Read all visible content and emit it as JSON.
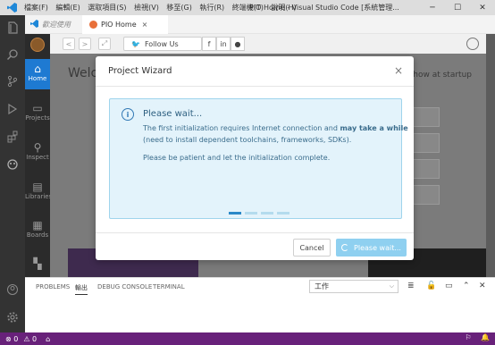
{
  "titlebar": {
    "menu": [
      "檔案(F)",
      "編輯(E)",
      "選取項目(S)",
      "檢視(V)",
      "移至(G)",
      "執行(R)",
      "終端機(T)",
      "說明(H)"
    ],
    "title": "PIO Home - Visual Studio Code [系統管理...",
    "minimize": "─",
    "maximize": "☐",
    "close": "✕"
  },
  "tabs": [
    {
      "label": "歡迎使用"
    },
    {
      "label": "PIO Home",
      "close": "×"
    }
  ],
  "pio_sidebar": {
    "items": [
      {
        "label": "Home"
      },
      {
        "label": "Projects"
      },
      {
        "label": "Inspect"
      },
      {
        "label": "Libraries"
      },
      {
        "label": "Boards"
      }
    ]
  },
  "toolbar": {
    "back": "<",
    "forward": ">",
    "expand": "⤢",
    "follow_label": "Follow Us"
  },
  "home": {
    "welcome": "Welco",
    "show_at_startup": "Show at startup"
  },
  "modal": {
    "title": "Project Wizard",
    "close": "×",
    "info_icon": "i",
    "heading": "Please wait...",
    "line1_prefix": "The first initialization requires Internet connection and ",
    "line1_bold": "may take a while",
    "line2": "(need to install dependent toolchains, frameworks, SDKs).",
    "line3": "Please be patient and let the initialization complete.",
    "progress": {
      "total": 4,
      "active": 1
    },
    "cancel_label": "Cancel",
    "wait_label": "Please wait..."
  },
  "panel": {
    "tabs": [
      "PROBLEMS",
      "輸出",
      "DEBUG CONSOLE",
      "TERMINAL"
    ],
    "active_tab": "輸出",
    "select_value": "工作"
  },
  "statusbar": {
    "errors": "⊗ 0",
    "warnings": "⚠ 0",
    "home": "⌂"
  },
  "colors": {
    "activity_bar": "#333333",
    "accent": "#1e7ad2",
    "status_bar": "#68217a",
    "info_bg": "#e3f3fb",
    "wait_button": "#8fd0f0"
  }
}
